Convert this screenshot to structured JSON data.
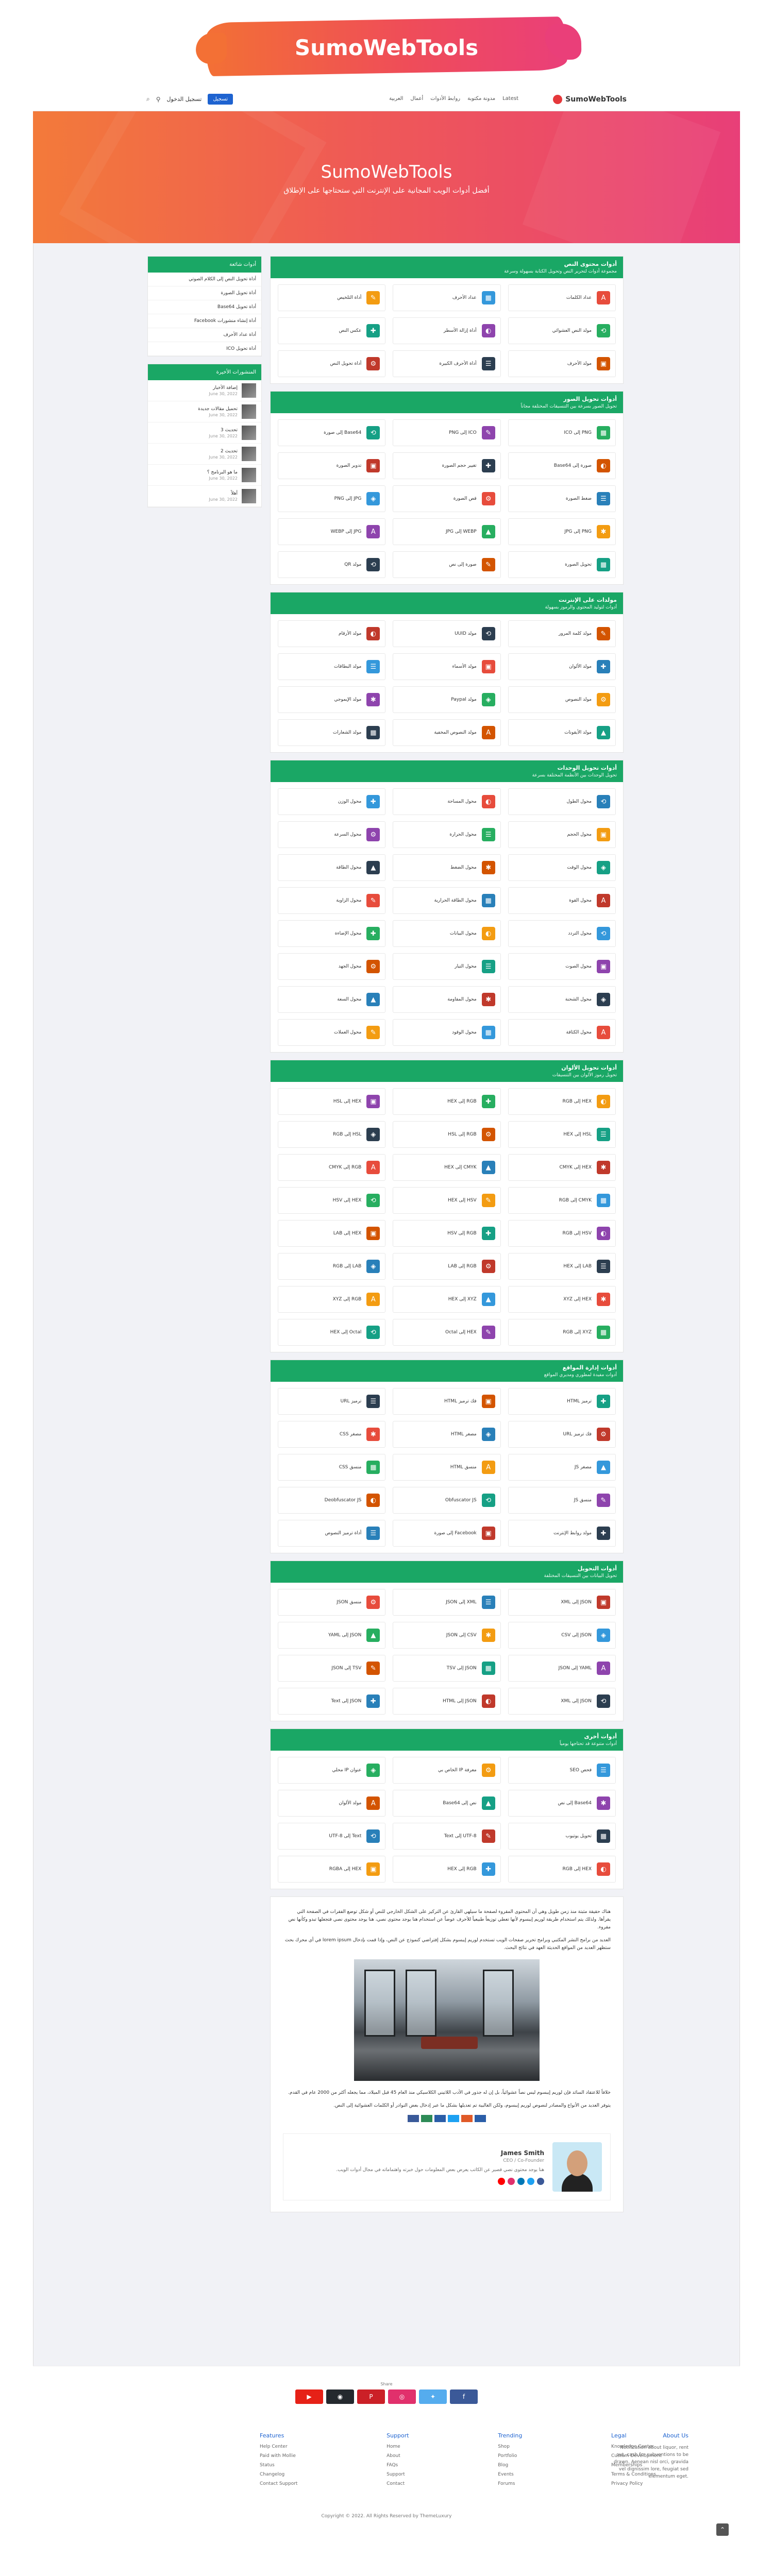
{
  "brand": "SumoWebTools",
  "nav": {
    "logo": "SumoWebTools",
    "links": [
      "Latest",
      "مدونة مكتوبة",
      "روابط الأدوات",
      "أعمال",
      "العربية"
    ],
    "login": "تسجيل الدخول",
    "signup": "تسجيل"
  },
  "hero": {
    "title": "SumoWebTools",
    "subtitle": "أفضل أدوات الويب المجانية على الإنترنت التي ستحتاجها على الإطلاق"
  },
  "sidebar": {
    "popular_title": "أدوات شائعة",
    "popular": [
      "أداة تحويل النص إلى الكلام الصوتي",
      "أداة تحويل الصورة",
      "أداة تحويل Base64",
      "أداة إنشاء منشورات Facebook",
      "أداة عداد الأحرف",
      "أداة تحويل ICO"
    ],
    "recent_title": "المنشورات الأخيرة",
    "recent": [
      {
        "title": "إضافة الأخبار",
        "date": "June 30, 2022"
      },
      {
        "title": "تحميل مقالات جديدة",
        "date": "June 30, 2022"
      },
      {
        "title": "تحديث 3",
        "date": "June 30, 2022"
      },
      {
        "title": "تحديث 2",
        "date": "June 30, 2022"
      },
      {
        "title": "ما هو البرنامج ؟",
        "date": "June 30, 2022"
      },
      {
        "title": "أهلاً",
        "date": "June 30, 2022"
      }
    ]
  },
  "sections": [
    {
      "title": "أدوات محتوى النص",
      "subtitle": "مجموعة أدوات لتحرير النص وتحويل الكتابة بسهولة وسرعة",
      "items": [
        "عداد الكلمات",
        "عداد الأحرف",
        "أداة التلخيص",
        "مولد النص العشوائي",
        "أداة إزالة الأسطر",
        "عكس النص",
        "مولد الأحرف",
        "أداة الأحرف الكبيرة",
        "أداة تحويل النص"
      ]
    },
    {
      "title": "أدوات تحويل الصور",
      "subtitle": "تحويل الصور بسرعة بين التنسيقات المختلفة مجاناً",
      "items": [
        "PNG إلى ICO",
        "ICO إلى PNG",
        "Base64 إلى صورة",
        "صورة إلى Base64",
        "تغيير حجم الصورة",
        "تدوير الصورة",
        "ضغط الصورة",
        "قص الصورة",
        "JPG إلى PNG",
        "PNG إلى JPG",
        "WEBP إلى JPG",
        "JPG إلى WEBP",
        "تحويل الصورة",
        "صورة إلى نص",
        "مولد QR"
      ]
    },
    {
      "title": "مولدات على الإنترنت",
      "subtitle": "أدوات لتوليد المحتوى والرموز بسهولة",
      "items": [
        "مولد كلمة المرور",
        "مولد UUID",
        "مولد الأرقام",
        "مولد الألوان",
        "مولد الأسماء",
        "مولد البطاقات",
        "مولد النصوص",
        "مولد Paypal",
        "مولد الإيموجي",
        "مولد الأيقونات",
        "مولد النصوص المخفية",
        "مولد الشعارات"
      ]
    },
    {
      "title": "أدوات تحويل الوحدات",
      "subtitle": "تحويل الوحدات بين الأنظمة المختلفة بسرعة",
      "items": [
        "محول الطول",
        "محول المساحة",
        "محول الوزن",
        "محول الحجم",
        "محول الحرارة",
        "محول السرعة",
        "محول الوقت",
        "محول الضغط",
        "محول الطاقة",
        "محول القوة",
        "محول الطاقة الحرارية",
        "محول الزاوية",
        "محول التردد",
        "محول البيانات",
        "محول الإضاءة",
        "محول الصوت",
        "محول التيار",
        "محول الجهد",
        "محول الشحنة",
        "محول المقاومة",
        "محول السعة",
        "محول الكثافة",
        "محول الوقود",
        "محول العملات"
      ]
    },
    {
      "title": "أدوات تحويل الألوان",
      "subtitle": "تحويل رموز الألوان بين التنسيقات",
      "items": [
        "HEX إلى RGB",
        "RGB إلى HEX",
        "HEX إلى HSL",
        "HSL إلى HEX",
        "RGB إلى HSL",
        "HSL إلى RGB",
        "HEX إلى CMYK",
        "CMYK إلى HEX",
        "RGB إلى CMYK",
        "CMYK إلى RGB",
        "HSV إلى HEX",
        "HEX إلى HSV",
        "HSV إلى RGB",
        "RGB إلى HSV",
        "HEX إلى LAB",
        "LAB إلى HEX",
        "RGB إلى LAB",
        "LAB إلى RGB",
        "HEX إلى XYZ",
        "XYZ إلى HEX",
        "RGB إلى XYZ",
        "XYZ إلى RGB",
        "HEX إلى Octal",
        "Octal إلى HEX"
      ]
    },
    {
      "title": "أدوات إدارة المواقع",
      "subtitle": "أدوات مفيدة لمطوري ومديري المواقع",
      "items": [
        "ترميز HTML",
        "فك ترميز HTML",
        "ترميز URL",
        "فك ترميز URL",
        "مصغر HTML",
        "مصغر CSS",
        "مصغر JS",
        "منسق HTML",
        "منسق CSS",
        "منسق JS",
        "Obfuscator JS",
        "Deobfuscator JS",
        "مولد روابط الإنترنت",
        "Facebook إلى صورة",
        "أداة ترميز النصوص"
      ]
    },
    {
      "title": "أدوات التحويل",
      "subtitle": "تحويل البيانات بين التنسيقات المختلفة",
      "items": [
        "JSON إلى XML",
        "XML إلى JSON",
        "منسق JSON",
        "JSON إلى CSV",
        "CSV إلى JSON",
        "JSON إلى YAML",
        "YAML إلى JSON",
        "JSON إلى TSV",
        "TSV إلى JSON",
        "JSON إلى XML",
        "JSON إلى HTML",
        "JSON إلى Text"
      ]
    },
    {
      "title": "أدوات أخرى",
      "subtitle": "أدوات متنوعة قد تحتاجها يومياً",
      "items": [
        "فحص SEO",
        "معرفة IP الخاص بي",
        "عنوان IP محلي",
        "Base64 إلى نص",
        "نص إلى Base64",
        "مولد الألوان",
        "تحويل يوتيوب",
        "UTF-8 إلى Text",
        "Text إلى UTF-8",
        "HEX إلى RGB",
        "RGB إلى HEX",
        "HEX إلى RGBA"
      ]
    }
  ],
  "article": {
    "para1": "هناك حقيقة مثبتة منذ زمن طويل وهي أن المحتوى المقروء لصفحة ما سيلهي القارئ عن التركيز على الشكل الخارجي للنص أو شكل توضع الفقرات في الصفحة التي يقرأها. ولذلك يتم استخدام طريقة لوريم إيبسوم لأنها تعطي توزيعاً طبيعياً للأحرف عوضاً عن استخدام هنا يوجد محتوى نصي، هنا يوجد محتوى نصي فتجعلها تبدو وكأنها نص مقروء.",
    "para2": "العديد من برامح النشر المكتبي وبرامح تحرير صفحات الويب تستخدم لوريم إيبسوم بشكل إفتراضي كنموذج عن النص، وإذا قمت بإدخال lorem ipsum في أي محرك بحث ستظهر العديد من المواقع الحديثة العهد في نتائج البحث.",
    "para3": "خلافاً للاعتقاد السائد فإن لوريم إيبسوم ليس نصاً عشوائياً، بل إن له جذور في الأدب اللاتيني الكلاسيكي منذ العام 45 قبل الميلاد، مما يجعله أكثر من 2000 عام في القدم.",
    "para4": "يتوفر العديد من الأنواع والمصادر لنصوص لوريم إيبسوم، ولكن الغالبية تم تعديلها بشكل ما عبر إدخال بعض النوادر أو الكلمات العشوائية إلى النص.",
    "author_name": "James Smith",
    "author_role": "CEO / Co-Founder",
    "author_bio": "هنا يوجد محتوى نصي قصير عن الكاتب يعرض بعض المعلومات حول خبرته واهتماماته في مجال أدوات الويب."
  },
  "footer": {
    "social_label": "Share",
    "about_title": "About Us",
    "about_text": "Notification about liquor, rent out, cash for subventions to be drawn. Aenean nisl orci, gravida vel dignissim lore, feugiat sed elementum eget.",
    "cols": [
      {
        "title": "Features",
        "items": [
          "Help Center",
          "Paid with Mollie",
          "Status",
          "Changelog",
          "Contact Support"
        ]
      },
      {
        "title": "Support",
        "items": [
          "Home",
          "About",
          "FAQs",
          "Support",
          "Contact"
        ]
      },
      {
        "title": "Trending",
        "items": [
          "Shop",
          "Portfolio",
          "Blog",
          "Events",
          "Forums"
        ]
      },
      {
        "title": "Legal",
        "items": [
          "Knowledge Center",
          "Custom Development",
          "Memberships",
          "Terms & Conditions",
          "Privacy Policy"
        ]
      }
    ],
    "copyright": "Copyright © 2022. All Rights Reserved by ThemeLuxury"
  }
}
